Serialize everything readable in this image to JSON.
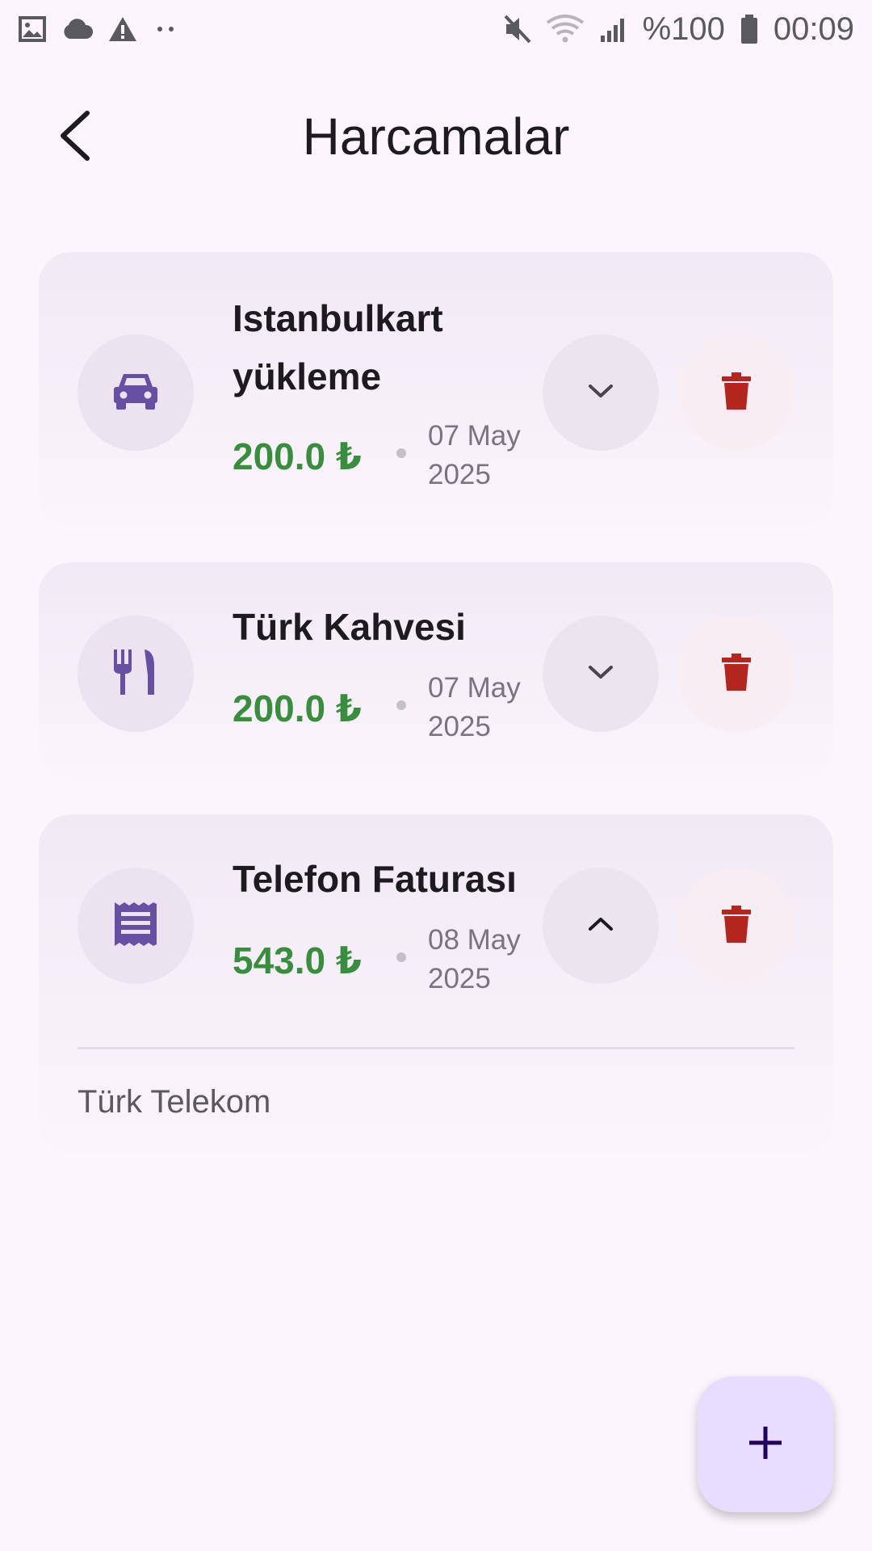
{
  "status_bar": {
    "left_icons": [
      "image-icon",
      "cloud-icon",
      "warning-icon",
      "more-dots-icon"
    ],
    "right_icons": [
      "mute-icon",
      "wifi-icon",
      "signal-icon",
      "battery-icon"
    ],
    "battery": "%100",
    "time": "00:09"
  },
  "header": {
    "title": "Harcamalar",
    "back_icon": "back-arrow-icon"
  },
  "expenses": [
    {
      "name": "Istanbulkart yükleme",
      "amount": "200.0 ₺",
      "date": "07 May 2025",
      "category_icon": "car-icon",
      "expanded": false
    },
    {
      "name": "Türk Kahvesi",
      "amount": "200.0 ₺",
      "date": "07 May 2025",
      "category_icon": "restaurant-icon",
      "expanded": false
    },
    {
      "name": "Telefon Faturası",
      "amount": "543.0 ₺",
      "date": "08 May 2025",
      "category_icon": "receipt-icon",
      "expanded": true,
      "note": "Türk Telekom"
    }
  ],
  "fab": {
    "icon": "plus-icon"
  },
  "colors": {
    "background": "#fcf6fc",
    "amount": "#388e3c",
    "delete": "#b3261e",
    "category_icon": "#6750a4",
    "fab": "#e9ddff"
  }
}
